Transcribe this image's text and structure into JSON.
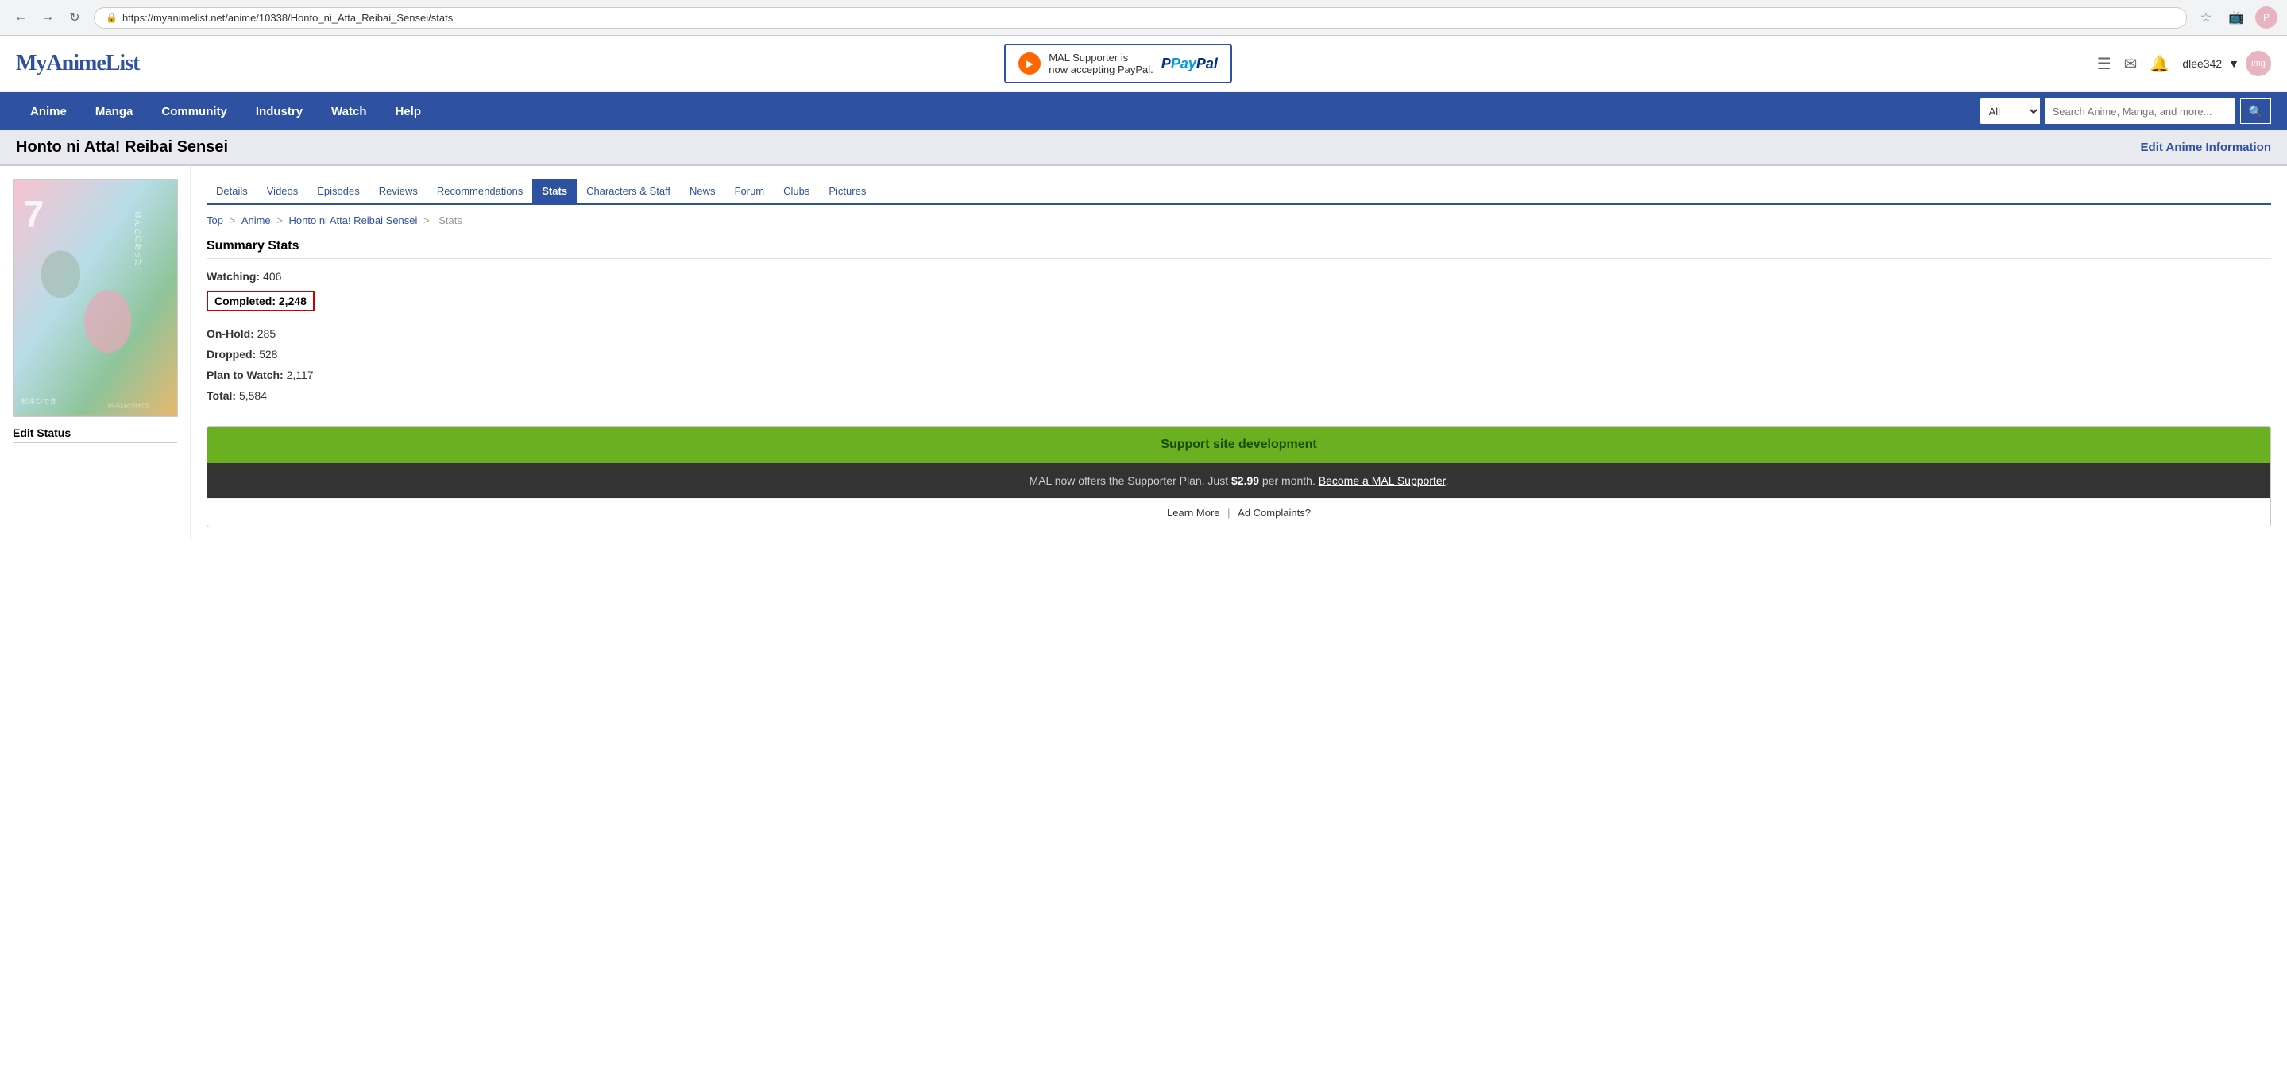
{
  "browser": {
    "url": "https://myanimelist.net/anime/10338/Honto_ni_Atta_Reibai_Sensei/stats",
    "secure_label": "Secure"
  },
  "site": {
    "logo": "MyAnimeList",
    "paypal_banner": {
      "line1": "MAL Supporter is",
      "line2": "now accepting PayPal.",
      "paypal_text": "PayPal"
    },
    "user": "dlee342",
    "header_icons": {
      "menu": "☰",
      "mail": "✉",
      "bell": "🔔"
    }
  },
  "nav": {
    "items": [
      {
        "label": "Anime",
        "id": "anime"
      },
      {
        "label": "Manga",
        "id": "manga"
      },
      {
        "label": "Community",
        "id": "community"
      },
      {
        "label": "Industry",
        "id": "industry"
      },
      {
        "label": "Watch",
        "id": "watch"
      },
      {
        "label": "Help",
        "id": "help"
      }
    ],
    "search_placeholder": "Search Anime, Manga, and more...",
    "search_filter_default": "All"
  },
  "page": {
    "title": "Honto ni Atta! Reibai Sensei",
    "edit_link": "Edit Anime Information"
  },
  "sub_nav": {
    "items": [
      {
        "label": "Details",
        "id": "details",
        "active": false
      },
      {
        "label": "Videos",
        "id": "videos",
        "active": false
      },
      {
        "label": "Episodes",
        "id": "episodes",
        "active": false
      },
      {
        "label": "Reviews",
        "id": "reviews",
        "active": false
      },
      {
        "label": "Recommendations",
        "id": "recommendations",
        "active": false
      },
      {
        "label": "Stats",
        "id": "stats",
        "active": true
      },
      {
        "label": "Characters & Staff",
        "id": "characters-staff",
        "active": false
      },
      {
        "label": "News",
        "id": "news",
        "active": false
      },
      {
        "label": "Forum",
        "id": "forum",
        "active": false
      },
      {
        "label": "Clubs",
        "id": "clubs",
        "active": false
      },
      {
        "label": "Pictures",
        "id": "pictures",
        "active": false
      }
    ]
  },
  "breadcrumb": {
    "items": [
      {
        "label": "Top",
        "href": "#"
      },
      {
        "label": "Anime",
        "href": "#"
      },
      {
        "label": "Honto ni Atta! Reibai Sensei",
        "href": "#"
      },
      {
        "label": "Stats",
        "href": null
      }
    ]
  },
  "stats": {
    "section_title": "Summary Stats",
    "rows": [
      {
        "label": "Watching:",
        "value": "406",
        "highlighted": false
      },
      {
        "label": "Completed:",
        "value": "2,248",
        "highlighted": true
      },
      {
        "label": "On-Hold:",
        "value": "285",
        "highlighted": false
      },
      {
        "label": "Dropped:",
        "value": "528",
        "highlighted": false
      },
      {
        "label": "Plan to Watch:",
        "value": "2,117",
        "highlighted": false
      },
      {
        "label": "Total:",
        "value": "5,584",
        "highlighted": false
      }
    ]
  },
  "sidebar": {
    "edit_status_label": "Edit Status"
  },
  "support": {
    "title": "Support site development",
    "description_prefix": "MAL now offers the Supporter Plan. Just ",
    "price": "$2.99",
    "description_suffix": " per month.",
    "cta_link": "Become a MAL Supporter",
    "footer_learn_more": "Learn More",
    "footer_ad": "Ad Complaints?",
    "pipe": "|"
  }
}
